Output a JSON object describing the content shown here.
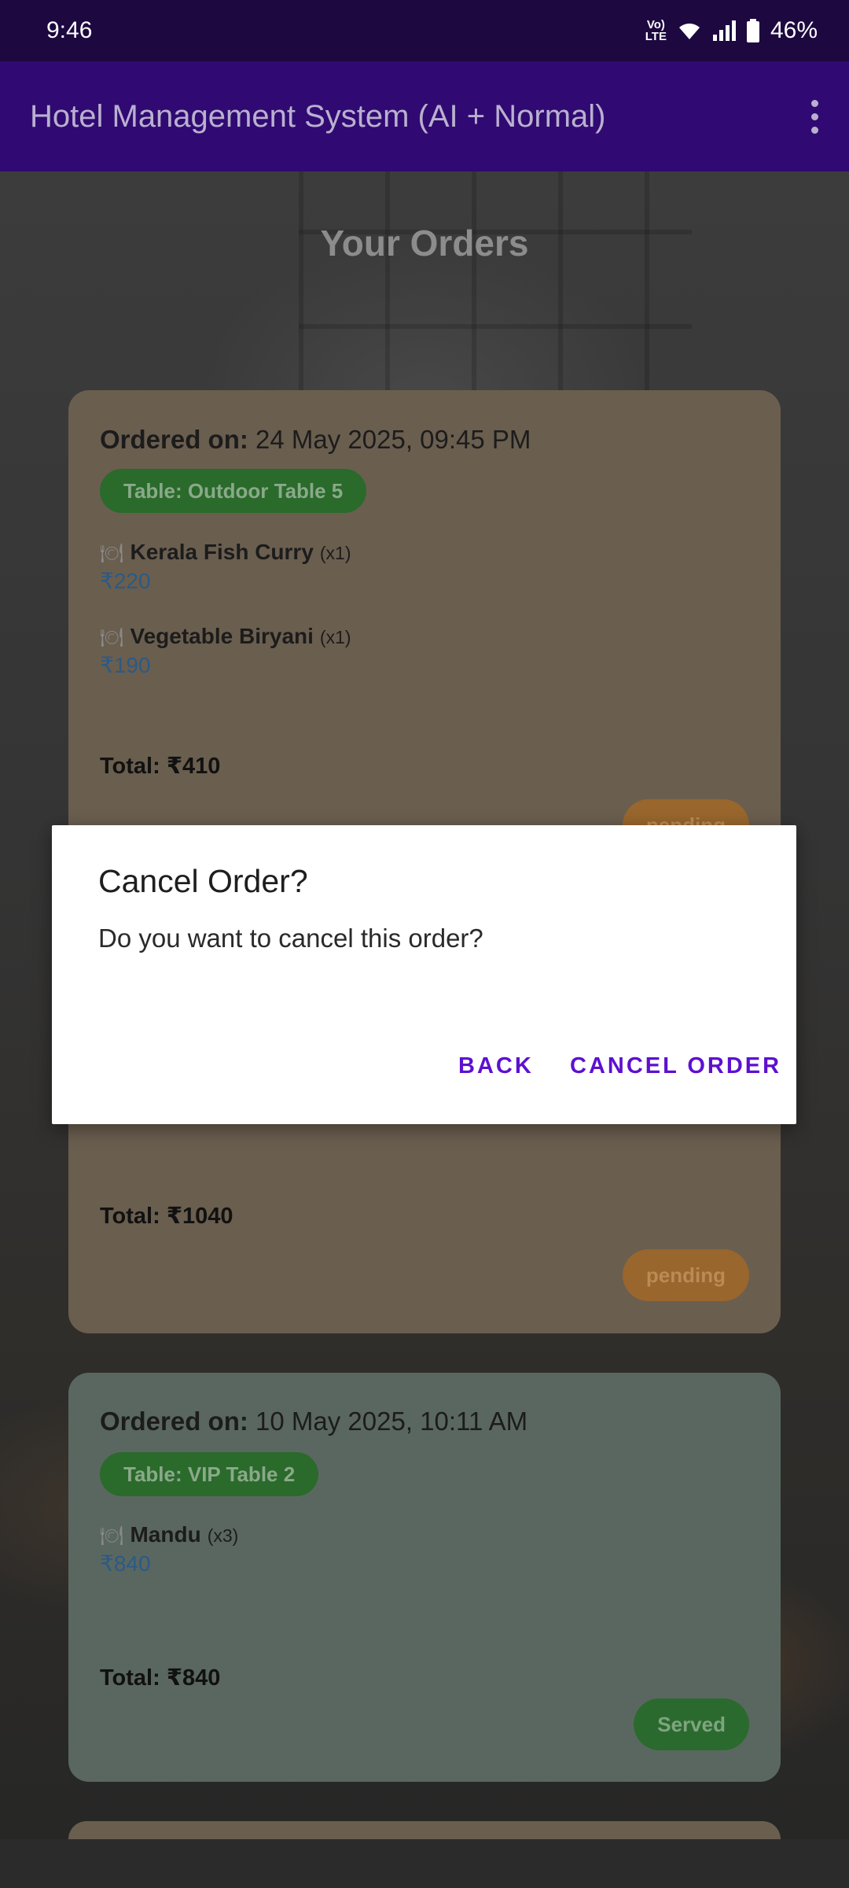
{
  "status_bar": {
    "time": "9:46",
    "network": "VoLTE",
    "battery": "46%"
  },
  "app_bar": {
    "title": "Hotel Management System (AI + Normal)"
  },
  "page": {
    "heading": "Your Orders"
  },
  "orders": [
    {
      "ordered_label": "Ordered on:",
      "ordered_date": "24 May 2025, 09:45 PM",
      "table": "Table: Outdoor Table 5",
      "items": [
        {
          "name": "Kerala Fish Curry",
          "qty": "(x1)",
          "price": "₹220"
        },
        {
          "name": "Vegetable Biryani",
          "qty": "(x1)",
          "price": "₹190"
        }
      ],
      "total": "Total: ₹410",
      "status": "pending"
    },
    {
      "total": "Total: ₹1040",
      "status": "pending"
    },
    {
      "ordered_label": "Ordered on:",
      "ordered_date": "10 May 2025, 10:11 AM",
      "table": "Table: VIP Table 2",
      "items": [
        {
          "name": "Mandu",
          "qty": "(x3)",
          "price": "₹840"
        }
      ],
      "total": "Total: ₹840",
      "status": "Served"
    }
  ],
  "dialog": {
    "title": "Cancel Order?",
    "message": "Do you want to cancel this order?",
    "back_label": "BACK",
    "confirm_label": "CANCEL ORDER"
  },
  "colors": {
    "accent": "#5d10d0",
    "app_bar": "#300a72",
    "status_bar": "#1d0840"
  }
}
